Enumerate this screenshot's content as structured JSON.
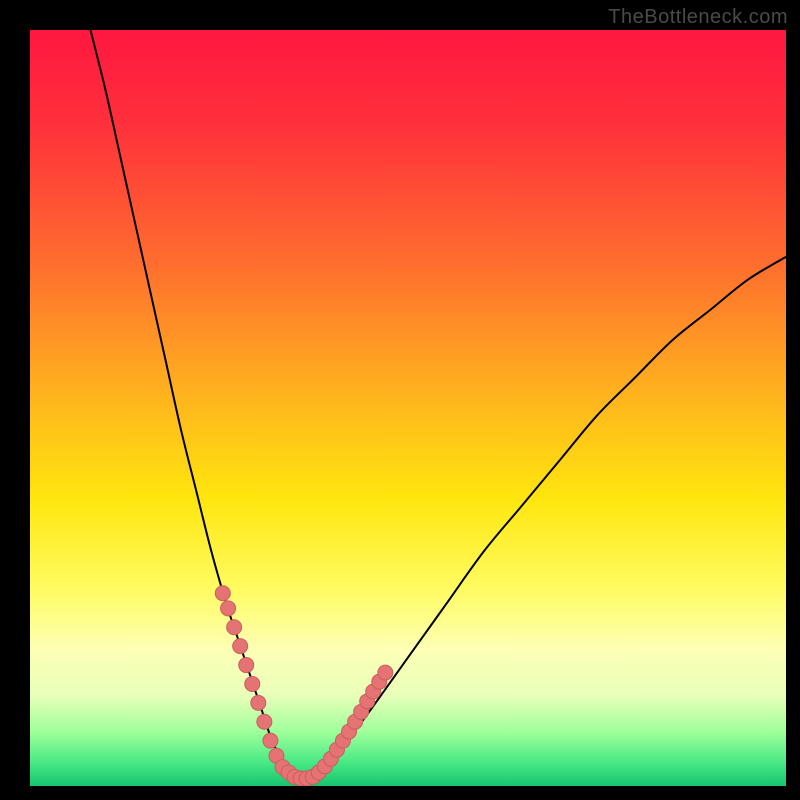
{
  "watermark": "TheBottleneck.com",
  "colors": {
    "frame": "#000000",
    "gradient_stops": [
      {
        "offset": 0.0,
        "color": "#ff173f"
      },
      {
        "offset": 0.12,
        "color": "#ff2f3c"
      },
      {
        "offset": 0.3,
        "color": "#ff6a2f"
      },
      {
        "offset": 0.48,
        "color": "#ffb21e"
      },
      {
        "offset": 0.62,
        "color": "#ffe60e"
      },
      {
        "offset": 0.74,
        "color": "#fffc63"
      },
      {
        "offset": 0.82,
        "color": "#fdffb5"
      },
      {
        "offset": 0.88,
        "color": "#e8ffb9"
      },
      {
        "offset": 0.93,
        "color": "#9cff9a"
      },
      {
        "offset": 0.97,
        "color": "#46e884"
      },
      {
        "offset": 1.0,
        "color": "#17c46f"
      }
    ],
    "curve": "#000000",
    "dot_fill": "#e57373",
    "dot_stroke": "#c95e5e"
  },
  "chart_data": {
    "type": "line",
    "title": "",
    "xlabel": "",
    "ylabel": "",
    "xlim": [
      0,
      100
    ],
    "ylim": [
      0,
      100
    ],
    "grid": false,
    "legend": false,
    "series": [
      {
        "name": "bottleneck-curve",
        "x": [
          8,
          10,
          12,
          14,
          16,
          18,
          20,
          22,
          24,
          26,
          27,
          28,
          29,
          30,
          31,
          32,
          33,
          34,
          35,
          36,
          37,
          38,
          40,
          42,
          45,
          50,
          55,
          60,
          65,
          70,
          75,
          80,
          85,
          90,
          95,
          100
        ],
        "values": [
          100,
          92,
          83,
          74,
          65,
          56,
          47,
          39,
          31,
          24,
          21,
          18,
          15,
          12,
          9,
          6,
          4,
          2.5,
          1.5,
          1,
          1,
          1.5,
          3,
          6,
          10,
          17,
          24,
          31,
          37,
          43,
          49,
          54,
          59,
          63,
          67,
          70
        ]
      }
    ],
    "highlight_points": {
      "name": "marked-points",
      "x": [
        25.5,
        26.2,
        27.0,
        27.8,
        28.6,
        29.4,
        30.2,
        31.0,
        31.8,
        32.6,
        33.4,
        34.2,
        35.0,
        35.8,
        36.6,
        37.4,
        38.2,
        39.0,
        39.8,
        40.6,
        41.4,
        42.2,
        43.0,
        43.8,
        44.6,
        45.4,
        46.2,
        47.0
      ],
      "values": [
        25.5,
        23.5,
        21.0,
        18.5,
        16.0,
        13.5,
        11.0,
        8.5,
        6.0,
        4.0,
        2.5,
        1.8,
        1.2,
        1.0,
        1.0,
        1.2,
        1.8,
        2.6,
        3.6,
        4.8,
        6.0,
        7.2,
        8.5,
        9.8,
        11.2,
        12.5,
        13.8,
        15.0
      ]
    }
  }
}
